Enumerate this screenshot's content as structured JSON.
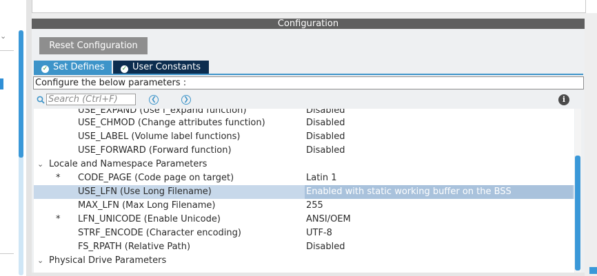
{
  "config_panel": {
    "title": "Configuration",
    "reset_button_label": "Reset Configuration",
    "tabs": [
      {
        "label": "Set Defines",
        "active": true
      },
      {
        "label": "User Constants",
        "active": false
      }
    ],
    "instructions": "Configure the below parameters :",
    "search": {
      "placeholder": "Search (Ctrl+F)",
      "value": ""
    }
  },
  "icons": {
    "search": "search-icon",
    "prev": "chevron-left-circle-icon",
    "next": "chevron-right-circle-icon",
    "info": "info-icon",
    "check": "check-circle-icon"
  },
  "colors": {
    "accent": "#3d94c9",
    "tab_dark": "#0c2d4f",
    "header_bg": "#5f5f5f",
    "selection": "#c7d8ea"
  },
  "tree": {
    "rows": [
      {
        "type": "param",
        "name": "USE_EXPAND (Use f_expand function)",
        "value": "Disabled",
        "star": ""
      },
      {
        "type": "param",
        "name": "USE_CHMOD (Change attributes function)",
        "value": "Disabled",
        "star": ""
      },
      {
        "type": "param",
        "name": "USE_LABEL (Volume label functions)",
        "value": "Disabled",
        "star": ""
      },
      {
        "type": "param",
        "name": "USE_FORWARD (Forward function)",
        "value": "Disabled",
        "star": ""
      },
      {
        "type": "group",
        "name": "Locale and Namespace Parameters",
        "expanded": true
      },
      {
        "type": "param",
        "name": "CODE_PAGE (Code page on target)",
        "value": "Latin 1",
        "star": "*"
      },
      {
        "type": "param",
        "name": "USE_LFN (Use Long Filename)",
        "value": "Enabled with static working buffer on the BSS",
        "star": "",
        "selected": true
      },
      {
        "type": "param",
        "name": "MAX_LFN (Max Long Filename)",
        "value": "255",
        "star": ""
      },
      {
        "type": "param",
        "name": "LFN_UNICODE (Enable Unicode)",
        "value": "ANSI/OEM",
        "star": "*"
      },
      {
        "type": "param",
        "name": "STRF_ENCODE (Character encoding)",
        "value": "UTF-8",
        "star": ""
      },
      {
        "type": "param",
        "name": "FS_RPATH (Relative Path)",
        "value": "Disabled",
        "star": ""
      },
      {
        "type": "group",
        "name": "Physical Drive Parameters",
        "expanded": true
      }
    ]
  }
}
